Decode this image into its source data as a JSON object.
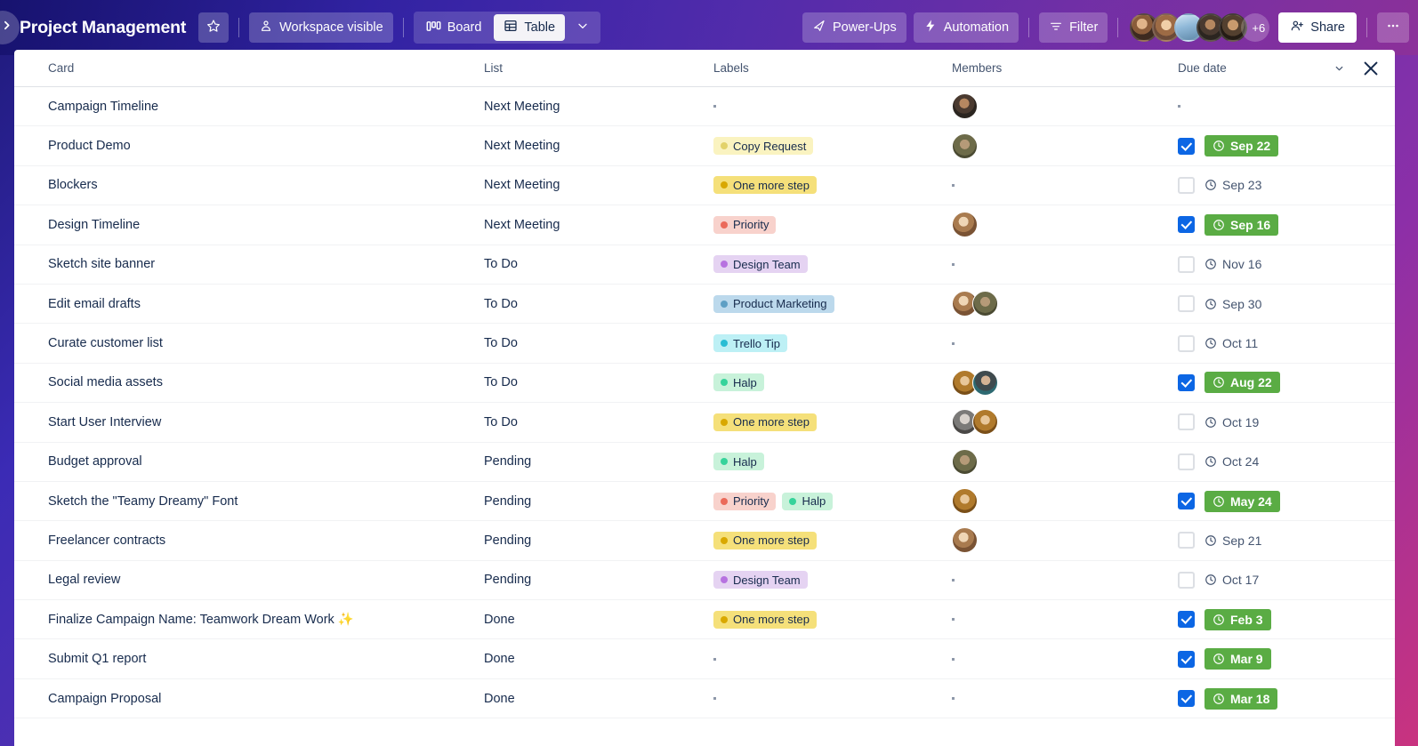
{
  "header": {
    "board_title": "Project Management",
    "star_icon": "star-icon",
    "workspace_visible_label": "Workspace visible",
    "workspace_icon": "person-shield-icon",
    "board_view_label": "Board",
    "board_icon": "board-columns-icon",
    "table_view_label": "Table",
    "table_icon": "table-grid-icon",
    "view_more_icon": "chevron-down-icon",
    "powerups_label": "Power-Ups",
    "powerups_icon": "rocket-icon",
    "automation_label": "Automation",
    "automation_icon": "lightning-bolt-icon",
    "filter_label": "Filter",
    "filter_icon": "filter-icon",
    "share_label": "Share",
    "share_icon": "person-add-icon",
    "overflow_icon": "ellipsis-icon",
    "collapse_icon": "chevron-right-icon",
    "members_overflow": "+6",
    "member_avatars": [
      "face1",
      "face2",
      "face3",
      "face4",
      "face5"
    ]
  },
  "table": {
    "columns": [
      "Card",
      "List",
      "Labels",
      "Members",
      "Due date"
    ],
    "collapse_icon": "chevron-down-icon",
    "close_icon": "close-icon",
    "clock_icon": "clock-icon",
    "rows": [
      {
        "card": "Campaign Timeline",
        "list": "Next Meeting",
        "labels": [],
        "members": [
          "face4"
        ],
        "due": null,
        "due_done": false,
        "has_due": false
      },
      {
        "card": "Product Demo",
        "list": "Next Meeting",
        "labels": [
          {
            "text": "Copy Request",
            "bg": "#faf3c0",
            "dot": "#e2d26a"
          }
        ],
        "members": [
          "face-olive"
        ],
        "due": "Sep 22",
        "due_done": true,
        "has_due": true
      },
      {
        "card": "Blockers",
        "list": "Next Meeting",
        "labels": [
          {
            "text": "One more step",
            "bg": "#f5e07a",
            "dot": "#d9a800"
          }
        ],
        "members": [],
        "due": "Sep 23",
        "due_done": false,
        "has_due": true
      },
      {
        "card": "Design Timeline",
        "list": "Next Meeting",
        "labels": [
          {
            "text": "Priority",
            "bg": "#f8d2cc",
            "dot": "#eb6a5a"
          }
        ],
        "members": [
          "face-hair"
        ],
        "due": "Sep 16",
        "due_done": true,
        "has_due": true
      },
      {
        "card": "Sketch site banner",
        "list": "To Do",
        "labels": [
          {
            "text": "Design Team",
            "bg": "#e5d3f2",
            "dot": "#b772e0"
          }
        ],
        "members": [],
        "due": "Nov 16",
        "due_done": false,
        "has_due": true
      },
      {
        "card": "Edit email drafts",
        "list": "To Do",
        "labels": [
          {
            "text": "Product Marketing",
            "bg": "#bcd9ec",
            "dot": "#5e9fc4"
          }
        ],
        "members": [
          "face-hair",
          "face-olive"
        ],
        "due": "Sep 30",
        "due_done": false,
        "has_due": true
      },
      {
        "card": "Curate customer list",
        "list": "To Do",
        "labels": [
          {
            "text": "Trello Tip",
            "bg": "#bdf0f5",
            "dot": "#29bdd4"
          }
        ],
        "members": [],
        "due": "Oct 11",
        "due_done": false,
        "has_due": true
      },
      {
        "card": "Social media assets",
        "list": "To Do",
        "labels": [
          {
            "text": "Halp",
            "bg": "#c8f2da",
            "dot": "#36d39b"
          }
        ],
        "members": [
          "face-gold",
          "face-teal"
        ],
        "due": "Aug 22",
        "due_done": true,
        "has_due": true
      },
      {
        "card": "Start User Interview",
        "list": "To Do",
        "labels": [
          {
            "text": "One more step",
            "bg": "#f5e07a",
            "dot": "#d9a800"
          }
        ],
        "members": [
          "face-gray",
          "face-gold"
        ],
        "due": "Oct 19",
        "due_done": false,
        "has_due": true
      },
      {
        "card": "Budget approval",
        "list": "Pending",
        "labels": [
          {
            "text": "Halp",
            "bg": "#c8f2da",
            "dot": "#36d39b"
          }
        ],
        "members": [
          "face-olive"
        ],
        "due": "Oct 24",
        "due_done": false,
        "has_due": true
      },
      {
        "card": "Sketch the \"Teamy Dreamy\" Font",
        "list": "Pending",
        "labels": [
          {
            "text": "Priority",
            "bg": "#f8d2cc",
            "dot": "#eb6a5a"
          },
          {
            "text": "Halp",
            "bg": "#c8f2da",
            "dot": "#36d39b"
          }
        ],
        "members": [
          "face-gold"
        ],
        "due": "May 24",
        "due_done": true,
        "has_due": true
      },
      {
        "card": "Freelancer contracts",
        "list": "Pending",
        "labels": [
          {
            "text": "One more step",
            "bg": "#f5e07a",
            "dot": "#d9a800"
          }
        ],
        "members": [
          "face-hair"
        ],
        "due": "Sep 21",
        "due_done": false,
        "has_due": true
      },
      {
        "card": "Legal review",
        "list": "Pending",
        "labels": [
          {
            "text": "Design Team",
            "bg": "#e5d3f2",
            "dot": "#b772e0"
          }
        ],
        "members": [],
        "due": "Oct 17",
        "due_done": false,
        "has_due": true
      },
      {
        "card": "Finalize Campaign Name: Teamwork Dream Work ✨",
        "list": "Done",
        "labels": [
          {
            "text": "One more step",
            "bg": "#f5e07a",
            "dot": "#d9a800"
          }
        ],
        "members": [],
        "due": "Feb 3",
        "due_done": true,
        "has_due": true
      },
      {
        "card": "Submit Q1 report",
        "list": "Done",
        "labels": [],
        "members": [],
        "due": "Mar 9",
        "due_done": true,
        "has_due": true
      },
      {
        "card": "Campaign Proposal",
        "list": "Done",
        "labels": [],
        "members": [],
        "due": "Mar 18",
        "due_done": true,
        "has_due": true
      }
    ]
  }
}
